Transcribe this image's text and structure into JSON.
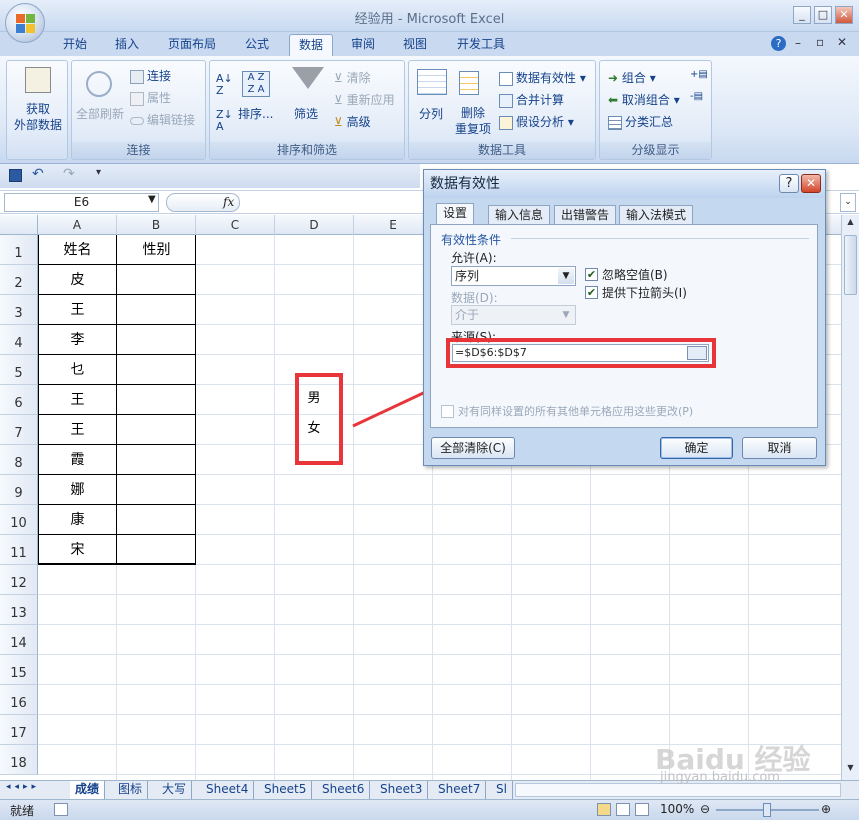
{
  "window": {
    "title": "经验用 - Microsoft Excel"
  },
  "ribbon_tabs": [
    "开始",
    "插入",
    "页面布局",
    "公式",
    "数据",
    "审阅",
    "视图",
    "开发工具"
  ],
  "ribbon": {
    "get_external": "获取\n外部数据",
    "refresh_all": "全部刷新",
    "connections": "连接",
    "properties": "属性",
    "edit_links": "编辑链接",
    "group_connections": "连接",
    "sort": "排序...",
    "filter": "筛选",
    "clear": "清除",
    "reapply": "重新应用",
    "advanced": "高级",
    "group_sort": "排序和筛选",
    "text_to_cols": "分列",
    "remove_dup": "删除\n重复项",
    "data_validation": "数据有效性",
    "consolidate": "合并计算",
    "what_if": "假设分析",
    "group_tools": "数据工具",
    "group_btn": "组合",
    "ungroup": "取消组合",
    "subtotal": "分类汇总",
    "group_outline": "分级显示"
  },
  "formula_bar": {
    "name_box": "E6",
    "fx": "fx",
    "formula": ""
  },
  "columns": [
    "A",
    "B",
    "C",
    "D",
    "E"
  ],
  "rows": [
    "1",
    "2",
    "3",
    "4",
    "5",
    "6",
    "7",
    "8",
    "9",
    "10",
    "11",
    "12",
    "13",
    "14",
    "15",
    "16",
    "17",
    "18"
  ],
  "cells": {
    "A": [
      "姓名",
      "皮",
      "王",
      "李",
      "乜",
      "王",
      "王",
      "霞",
      "娜",
      "康",
      "宋"
    ],
    "B1": "性别",
    "D6": "男",
    "D7": "女"
  },
  "sheet_tabs": [
    "成绩",
    "图标",
    "大写",
    "Sheet4",
    "Sheet5",
    "Sheet6",
    "Sheet3",
    "Sheet7",
    "Sl"
  ],
  "status": {
    "ready": "就绪",
    "zoom": "100%"
  },
  "dialog": {
    "title": "数据有效性",
    "tabs": [
      "设置",
      "输入信息",
      "出错警告",
      "输入法模式"
    ],
    "section": "有效性条件",
    "allow_label": "允许(A):",
    "allow_value": "序列",
    "ignore_blank": "忽略空值(B)",
    "dropdown": "提供下拉箭头(I)",
    "data_label": "数据(D):",
    "data_value": "介于",
    "source_label": "来源(S):",
    "source_value": "=$D$6:$D$7",
    "apply_all": "对有同样设置的所有其他单元格应用这些更改(P)",
    "clear_all": "全部清除(C)",
    "ok": "确定",
    "cancel": "取消"
  },
  "watermark": "Baidu 经验",
  "watermark_url": "jingyan.baidu.com",
  "colors": {
    "accent": "#e8353a",
    "ribbon": "#dce7f6"
  }
}
